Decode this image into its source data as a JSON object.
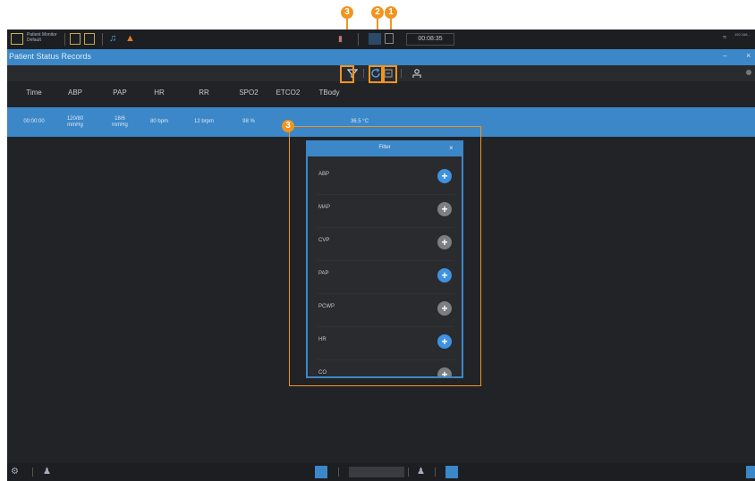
{
  "topbar": {
    "monitor_name_line1": "Patient Monitor",
    "monitor_name_line2": "Default",
    "timer": "00:08:35",
    "network_text": "192.168..."
  },
  "window": {
    "title": "Patient Status Records",
    "minimize": "–",
    "close": "×"
  },
  "toolbar": {
    "filter_icon": "filter-icon",
    "refresh_icon": "refresh-icon",
    "clear_icon": "clear-icon",
    "print_icon": "print-icon"
  },
  "table": {
    "columns": [
      "Time",
      "ABP",
      "PAP",
      "HR",
      "RR",
      "SPO2",
      "ETCO2",
      "TBody"
    ],
    "row": {
      "time": "00:00:00",
      "abp_value": "120/80",
      "abp_unit": "mmHg",
      "pap_value": "18/6",
      "pap_unit": "mmHg",
      "hr": "80 bpm",
      "rr": "12 brpm",
      "spo2": "98 %",
      "etco2": "",
      "tbody": "36.5 °C"
    }
  },
  "filter_panel": {
    "title": "Filter",
    "close": "×",
    "items": [
      {
        "label": "ABP",
        "enabled": true
      },
      {
        "label": "MAP",
        "enabled": false
      },
      {
        "label": "CVP",
        "enabled": false
      },
      {
        "label": "PAP",
        "enabled": true
      },
      {
        "label": "PCWP",
        "enabled": false
      },
      {
        "label": "HR",
        "enabled": true
      },
      {
        "label": "CO",
        "enabled": false
      }
    ]
  },
  "callouts": [
    "3",
    "2",
    "1",
    "3"
  ],
  "colors": {
    "accent": "#3b87c8",
    "callout": "#f0951f",
    "background": "#222326"
  }
}
